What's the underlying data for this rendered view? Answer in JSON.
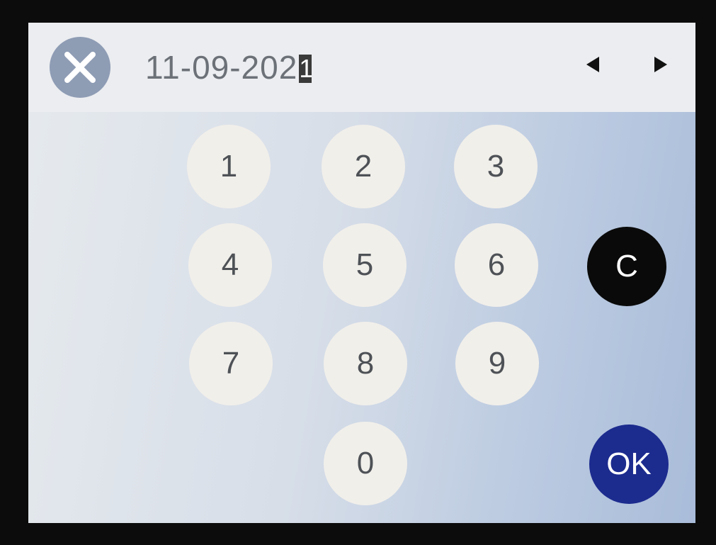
{
  "header": {
    "date_value": "11-09-202",
    "cursor_char": "1",
    "close_icon": "close-x-icon",
    "prev_icon": "triangle-left-icon",
    "next_icon": "triangle-right-icon"
  },
  "keypad": {
    "keys": [
      "1",
      "2",
      "3",
      "4",
      "5",
      "6",
      "7",
      "8",
      "9",
      "0"
    ],
    "clear_label": "C",
    "ok_label": "OK"
  },
  "colors": {
    "close_button": "#8e9cb4",
    "clear_button": "#0a0a0a",
    "ok_button": "#1c2b8e",
    "key_face": "#f1efea"
  }
}
